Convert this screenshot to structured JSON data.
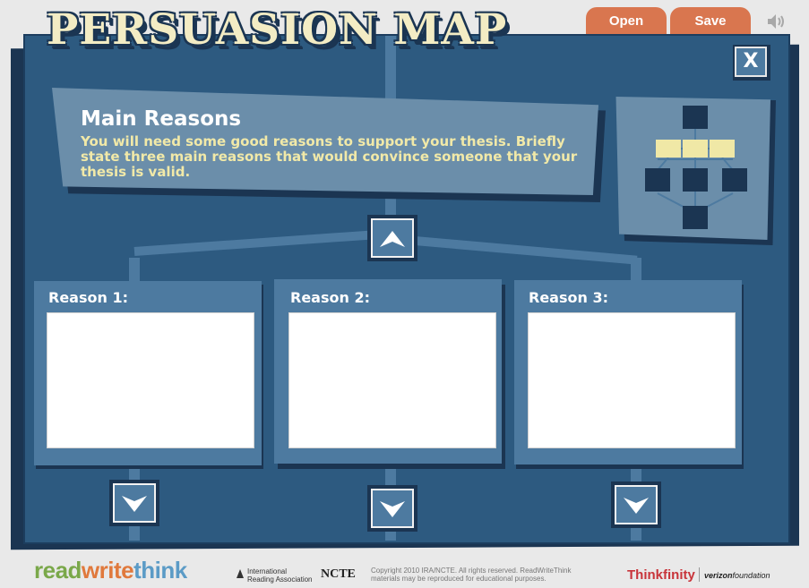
{
  "app": {
    "title": "PERSUASION MAP"
  },
  "toolbar": {
    "open_label": "Open",
    "save_label": "Save",
    "close_label": "X"
  },
  "icons": {
    "sound": "speaker-icon",
    "up": "up-arrow-icon",
    "down": "down-arrow-icon",
    "close": "close-icon"
  },
  "colors": {
    "board": "#2d5a80",
    "card": "#6b8eaa",
    "highlight": "#f0e8a6",
    "button": "#d9764f"
  },
  "section": {
    "title": "Main Reasons",
    "description": "You will need some good reasons to support your thesis. Briefly state three main reasons that would convince someone that your thesis is valid."
  },
  "reasons": [
    {
      "label": "Reason 1:",
      "value": ""
    },
    {
      "label": "Reason 2:",
      "value": ""
    },
    {
      "label": "Reason 3:",
      "value": ""
    }
  ],
  "footer": {
    "brand_read": "read",
    "brand_write": "write",
    "brand_think": "think",
    "ira_line1": "International",
    "ira_line2": "Reading Association",
    "ncte": "NCTE",
    "copyright_line1": "Copyright 2010 IRA/NCTE. All rights reserved. ReadWriteThink",
    "copyright_line2": "materials may be reproduced for educational purposes.",
    "thinkfinity": "Thinkfinity",
    "verizon": "verizon",
    "verizon_suffix": "foundation"
  }
}
